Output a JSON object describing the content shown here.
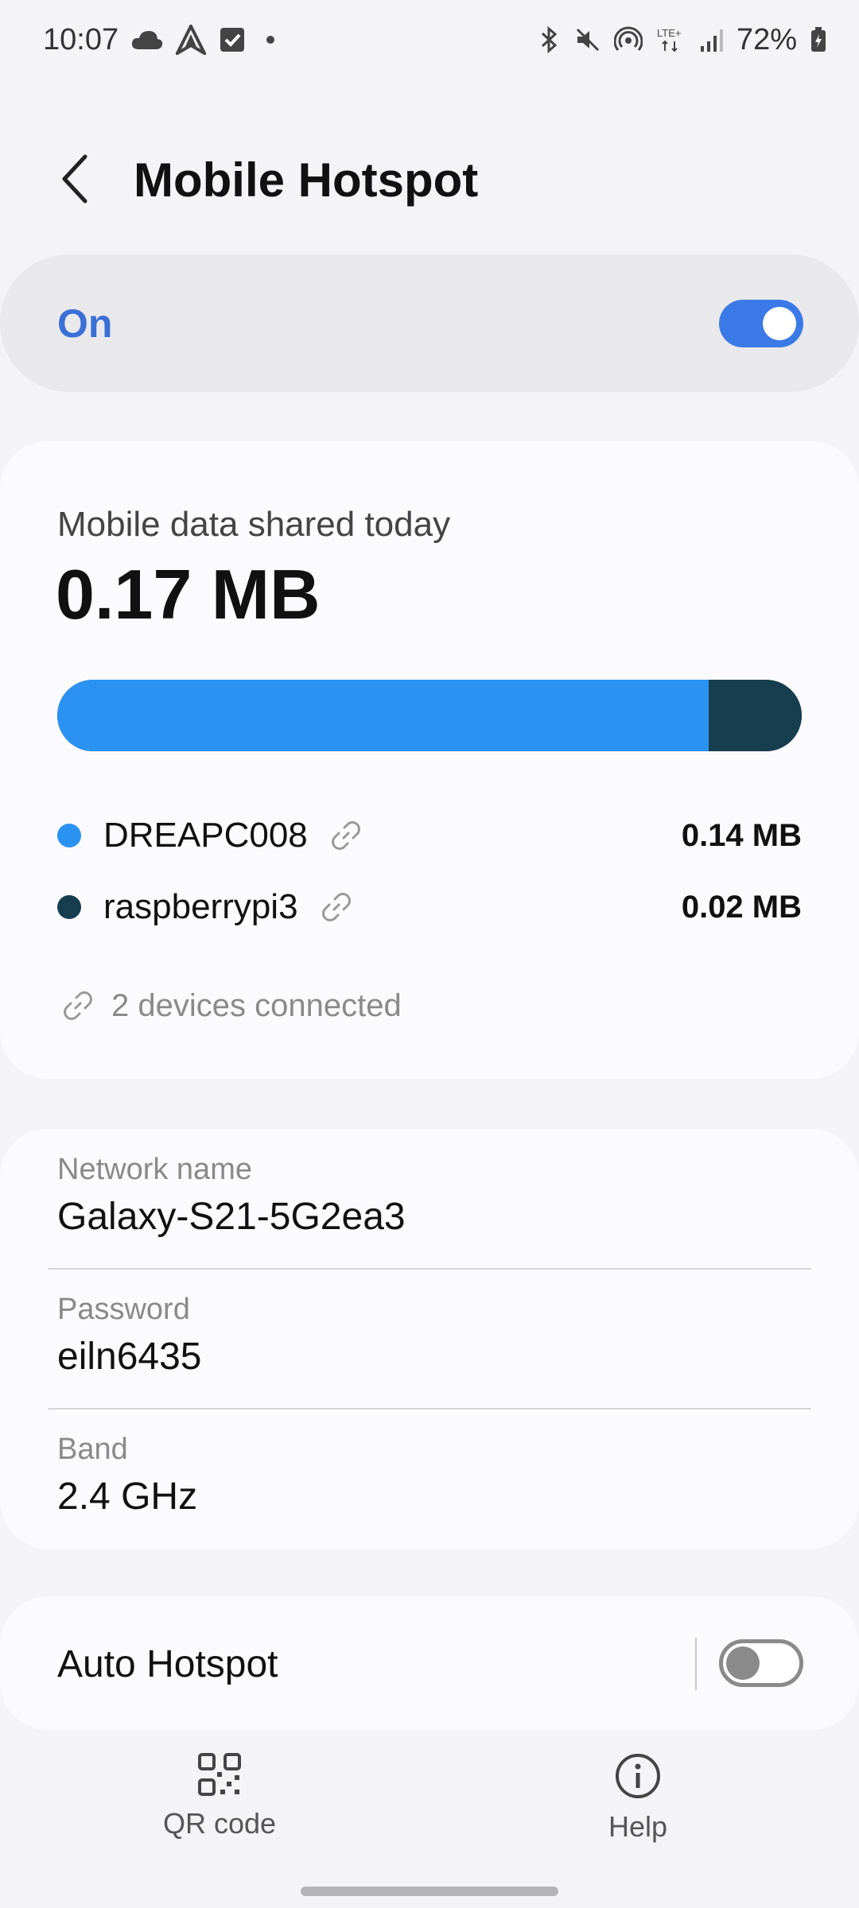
{
  "status_bar": {
    "time": "10:07",
    "battery": "72%",
    "network": "LTE+",
    "left_icons": [
      "cloud-icon",
      "navigation-app-icon",
      "checkbox-app-icon",
      "notification-dot-icon"
    ],
    "right_icons": [
      "bluetooth-icon",
      "mute-icon",
      "hotspot-icon",
      "lte-icon",
      "signal-icon",
      "battery-icon"
    ]
  },
  "header": {
    "title": "Mobile Hotspot"
  },
  "master_switch": {
    "label": "On",
    "enabled": true,
    "accent_color": "#3b6fd6"
  },
  "usage": {
    "title": "Mobile data shared today",
    "total": "0.17 MB",
    "bar_fraction_device_1": 0.875,
    "devices": [
      {
        "name": "DREAPC008",
        "usage": "0.14 MB",
        "color": "#2a93f2"
      },
      {
        "name": "raspberrypi3",
        "usage": "0.02 MB",
        "color": "#173e4e"
      }
    ],
    "connected_text": "2 devices connected"
  },
  "network": {
    "fields": [
      {
        "label": "Network name",
        "value": "Galaxy-S21-5G2ea3"
      },
      {
        "label": "Password",
        "value": "eiln6435"
      },
      {
        "label": "Band",
        "value": "2.4 GHz"
      }
    ]
  },
  "auto_hotspot": {
    "label": "Auto Hotspot",
    "enabled": false
  },
  "bottom_actions": {
    "qr_label": "QR code",
    "help_label": "Help"
  }
}
